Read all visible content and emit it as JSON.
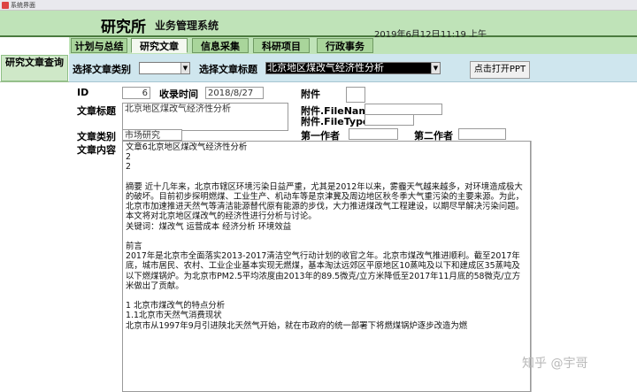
{
  "window": {
    "title": "系统界面"
  },
  "header": {
    "brand": "研究所",
    "subtitle": "业务管理系统",
    "date": "2019年6月12日",
    "time": "11:19 上午",
    "accent_color": "#bfe3b8"
  },
  "nav": {
    "tabs": [
      {
        "label": "计划与总结",
        "active": false
      },
      {
        "label": "研究文章",
        "active": true
      },
      {
        "label": "信息采集",
        "active": false
      },
      {
        "label": "科研项目",
        "active": false
      },
      {
        "label": "行政事务",
        "active": false
      }
    ]
  },
  "sidebar": {
    "query_button": "研究文章查询"
  },
  "filter": {
    "category_label": "选择文章类别",
    "category_value": "",
    "title_label": "选择文章标题",
    "title_value": "北京地区煤改气经济性分析",
    "open_ppt_button": "点击打开PPT"
  },
  "form": {
    "id_label": "ID",
    "id_value": "6",
    "received_label": "收录时间",
    "received_value": "2018/8/27",
    "attachment_label": "附件",
    "attachment_value": "",
    "article_title_label": "文章标题",
    "article_title_value": "北京地区煤改气经济性分析",
    "attachment_filename_label": "附件.FileName",
    "attachment_filename_value": "",
    "attachment_filetype_label": "附件.FileType",
    "attachment_filetype_value": "",
    "category_label": "文章类别",
    "category_value": "市场研究",
    "first_author_label": "第一作者",
    "first_author_value": "",
    "second_author_label": "第二作者",
    "second_author_value": "",
    "content_label": "文章内容",
    "content_lines": [
      "文章6北京地区煤改气经济性分析",
      "2",
      "2",
      "",
      "摘要 近十几年来，北京市辖区环境污染日益严重，尤其是2012年以来，雾霾天气越来越多，对环境造成极大的破坏。目前初步探明燃煤、工业生产、机动车等是京津冀及周边地区秋冬季大气重污染的主要来源。为此，北京市加速推进天然气等清洁能源替代原有能源的步伐，大力推进煤改气工程建设，以期尽早解决污染问题。本文将对北京地区煤改气的经济性进行分析与讨论。",
      "关键词：煤改气 运营成本 经济分析 环境效益",
      "",
      "前言",
      "2017年是北京市全面落实2013-2017清洁空气行动计划的收官之年。北京市煤改气推进顺利。截至2017年底，城市居民、农村、工业企业基本实现无燃煤，基本淘汰远郊区平原地区10蒸吨及以下和建成区35蒸吨及以下燃煤锅炉。为北京市PM2.5平均浓度由2013年的89.5微克/立方米降低至2017年11月底的58微克/立方米做出了贡献。",
      "",
      "1 北京市煤改气的特点分析",
      "1.1北京市天然气消费现状",
      "北京市从1997年9月引进陕北天然气开始，就在市政府的统一部署下将燃煤锅炉逐步改造为燃"
    ]
  },
  "watermark": "知乎 @宇哥"
}
